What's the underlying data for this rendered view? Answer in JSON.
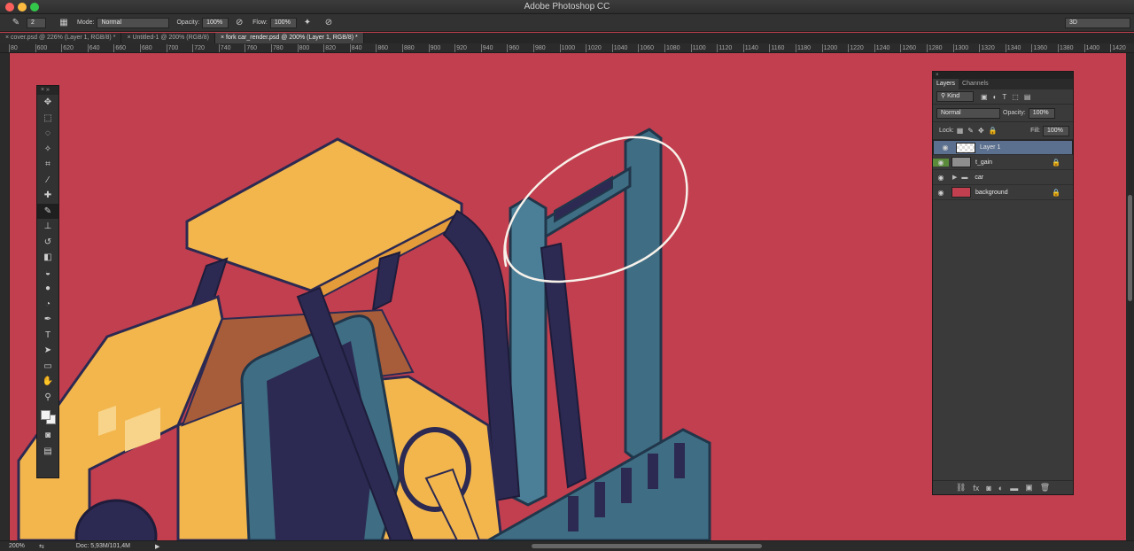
{
  "app_title": "Adobe Photoshop CC",
  "options": {
    "brush_size": "2",
    "mode_label": "Mode:",
    "mode_value": "Normal",
    "opacity_label": "Opacity:",
    "opacity_value": "100%",
    "flow_label": "Flow:",
    "flow_value": "100%",
    "workspace": "3D"
  },
  "tabs": [
    {
      "label": "cover.psd @ 226% (Layer 1, RGB/8) *"
    },
    {
      "label": "Untitled-1 @ 200% (RGB/8)"
    },
    {
      "label": "fork car_render.psd @ 200% (Layer 1, RGB/8) *"
    }
  ],
  "ruler": [
    "80",
    "600",
    "620",
    "640",
    "660",
    "680",
    "700",
    "720",
    "740",
    "760",
    "780",
    "800",
    "820",
    "840",
    "860",
    "880",
    "900",
    "920",
    "940",
    "960",
    "980",
    "1000",
    "1020",
    "1040",
    "1060",
    "1080",
    "1100",
    "1120",
    "1140",
    "1160",
    "1180",
    "1200",
    "1220",
    "1240",
    "1260",
    "1280",
    "1300",
    "1320",
    "1340",
    "1360",
    "1380",
    "1400",
    "1420"
  ],
  "status": {
    "zoom": "200%",
    "doc": "Doc: 5,93M/101,4M"
  },
  "layers_panel": {
    "tab_layers": "Layers",
    "tab_channels": "Channels",
    "filter": "Kind",
    "blend_mode": "Normal",
    "opacity_label": "Opacity:",
    "opacity_value": "100%",
    "lock_label": "Lock:",
    "fill_label": "Fill:",
    "fill_value": "100%",
    "layers": [
      {
        "name": "Layer 1",
        "selected": true,
        "locked": false,
        "thumb": "#e8e8e8"
      },
      {
        "name": "t_gain",
        "selected": false,
        "locked": true,
        "thumb": "#8e8e8e"
      },
      {
        "name": "car",
        "selected": false,
        "locked": false,
        "folder": true
      },
      {
        "name": "background",
        "selected": false,
        "locked": true,
        "thumb": "#c23f4f"
      }
    ]
  },
  "colors": {
    "canvas": "#c23f4f",
    "yellow": "#f3b64d",
    "navy": "#2c2a52",
    "steel": "#3f6e84"
  }
}
